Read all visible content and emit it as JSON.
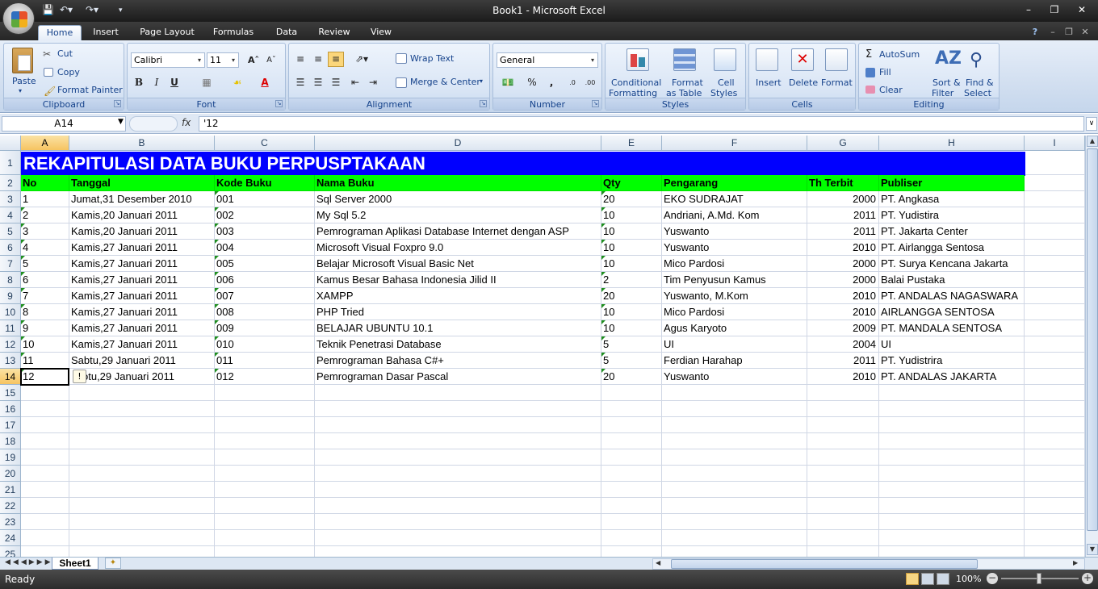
{
  "window": {
    "title_doc": "Book1",
    "title_sep": " - ",
    "title_app": "Microsoft Excel",
    "help": "?"
  },
  "tabs": [
    "Home",
    "Insert",
    "Page Layout",
    "Formulas",
    "Data",
    "Review",
    "View"
  ],
  "ribbon": {
    "clipboard": {
      "label": "Clipboard",
      "paste": "Paste",
      "cut": "Cut",
      "copy": "Copy",
      "format_painter": "Format Painter"
    },
    "font": {
      "label": "Font",
      "name": "Calibri",
      "size": "11",
      "bold": "B",
      "italic": "I",
      "underline": "U"
    },
    "alignment": {
      "label": "Alignment",
      "wrap": "Wrap Text",
      "merge": "Merge & Center"
    },
    "number": {
      "label": "Number",
      "format": "General",
      "percent": "%",
      "comma": ","
    },
    "styles": {
      "label": "Styles",
      "cond1": "Conditional",
      "cond2": "Formatting",
      "fmt1": "Format",
      "fmt2": "as Table",
      "cell1": "Cell",
      "cell2": "Styles"
    },
    "cells": {
      "label": "Cells",
      "insert": "Insert",
      "delete": "Delete",
      "format": "Format"
    },
    "editing": {
      "label": "Editing",
      "autosum": "AutoSum",
      "fill": "Fill",
      "clear": "Clear",
      "sort1": "Sort &",
      "sort2": "Filter",
      "find1": "Find &",
      "find2": "Select"
    }
  },
  "formula_bar": {
    "name_box": "A14",
    "fx": "fx",
    "formula": "'12"
  },
  "columns": [
    "A",
    "B",
    "C",
    "D",
    "E",
    "F",
    "G",
    "H",
    "I"
  ],
  "row_numbers": [
    "1",
    "2",
    "3",
    "4",
    "5",
    "6",
    "7",
    "8",
    "9",
    "10",
    "11",
    "12",
    "13",
    "14",
    "15",
    "16",
    "17",
    "18",
    "19",
    "20",
    "21",
    "22",
    "23",
    "24",
    "25"
  ],
  "sheet": {
    "title": "REKAPITULASI DATA BUKU PERPUSPTAKAAN",
    "headers": [
      "No",
      "Tanggal",
      "Kode Buku",
      "Nama Buku",
      "Qty",
      "Pengarang",
      "Th Terbit",
      "Publiser"
    ],
    "rows": [
      [
        "1",
        "Jumat,31 Desember 2010",
        "001",
        "Sql Server 2000",
        "20",
        "EKO SUDRAJAT",
        "2000",
        "PT. Angkasa"
      ],
      [
        "2",
        "Kamis,20 Januari 2011",
        "002",
        "My Sql 5.2",
        "10",
        "Andriani, A.Md. Kom",
        "2011",
        "PT. Yudistira"
      ],
      [
        "3",
        "Kamis,20 Januari 2011",
        "003",
        "Pemrograman Aplikasi Database Internet dengan ASP",
        "10",
        "Yuswanto",
        "2011",
        "PT. Jakarta Center"
      ],
      [
        "4",
        "Kamis,27 Januari 2011",
        "004",
        "Microsoft Visual Foxpro 9.0",
        "10",
        "Yuswanto",
        "2010",
        "PT. Airlangga Sentosa"
      ],
      [
        "5",
        "Kamis,27 Januari 2011",
        "005",
        "Belajar Microsoft Visual Basic Net",
        "10",
        "Mico Pardosi",
        "2000",
        "PT. Surya Kencana Jakarta"
      ],
      [
        "6",
        "Kamis,27 Januari 2011",
        "006",
        "Kamus Besar Bahasa Indonesia Jilid II",
        "2",
        "Tim Penyusun Kamus",
        "2000",
        "Balai Pustaka"
      ],
      [
        "7",
        "Kamis,27 Januari 2011",
        "007",
        "XAMPP",
        "20",
        "Yuswanto, M.Kom",
        "2010",
        "PT. ANDALAS NAGASWARA"
      ],
      [
        "8",
        "Kamis,27 Januari 2011",
        "008",
        "PHP Tried",
        "10",
        "Mico Pardosi",
        "2010",
        "AIRLANGGA SENTOSA"
      ],
      [
        "9",
        "Kamis,27 Januari 2011",
        "009",
        "BELAJAR UBUNTU 10.1",
        "10",
        "Agus Karyoto",
        "2009",
        "PT. MANDALA SENTOSA"
      ],
      [
        "10",
        "Kamis,27 Januari 2011",
        "010",
        "Teknik Penetrasi Database",
        "5",
        "UI",
        "2004",
        "UI"
      ],
      [
        "11",
        "Sabtu,29 Januari 2011",
        "011",
        "Pemrograman Bahasa C#+",
        "5",
        "Ferdian Harahap",
        "2011",
        "PT. Yudistrira"
      ],
      [
        "12",
        "otu,29 Januari 2011",
        "012",
        "Pemrograman Dasar Pascal",
        "20",
        "Yuswanto",
        "2010",
        "PT. ANDALAS JAKARTA"
      ]
    ]
  },
  "sheet_tabs": [
    "Sheet1"
  ],
  "status": {
    "ready": "Ready",
    "zoom": "100%"
  },
  "icons": [
    "office-button-icon",
    "save-icon",
    "undo-icon",
    "redo-icon",
    "minimize-icon",
    "restore-icon",
    "close-icon",
    "paste-icon",
    "cut-icon",
    "copy-icon",
    "format-painter-icon",
    "fx-icon",
    "warning-icon"
  ]
}
